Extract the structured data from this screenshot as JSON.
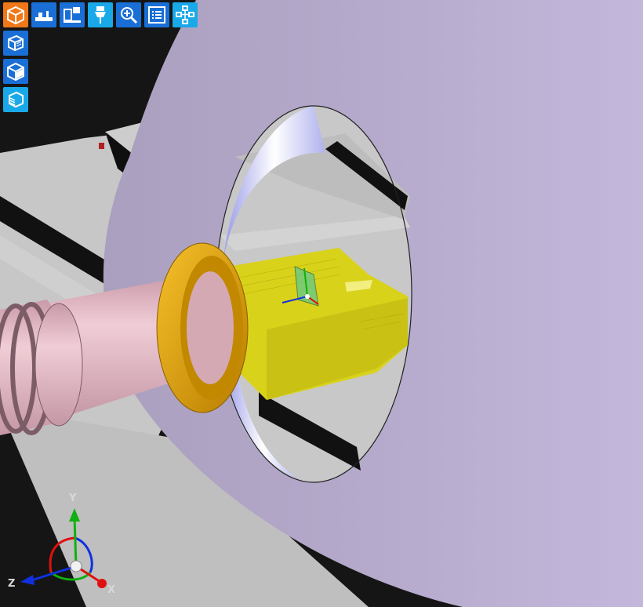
{
  "toolbar": {
    "buttons": [
      {
        "icon": "machine-view-icon",
        "color": "#f07818"
      },
      {
        "icon": "machine-setup-icon",
        "color": "#1a6fd6"
      },
      {
        "icon": "machine-panel-icon",
        "color": "#1a6fd6"
      },
      {
        "icon": "spindle-tool-icon",
        "color": "#1aa9e8"
      },
      {
        "icon": "zoom-icon",
        "color": "#1a6fd6"
      },
      {
        "icon": "list-icon",
        "color": "#1a6fd6"
      },
      {
        "icon": "network-icon",
        "color": "#1aa9e8"
      }
    ],
    "view_buttons": [
      {
        "icon": "front-view-icon",
        "color": "#1a6fd6"
      },
      {
        "icon": "iso-view-icon",
        "color": "#1a6fd6"
      },
      {
        "icon": "side-view-icon",
        "color": "#1aa9e8"
      }
    ]
  },
  "axes": {
    "x_label": "X",
    "y_label": "Y",
    "z_label": "Z",
    "x_color": "#e01010",
    "y_color": "#10b010",
    "z_color": "#1030e0"
  },
  "colors": {
    "housing": "#bdb0d4",
    "stock": "#d9d21a",
    "chuck_ring": "#e0a30a",
    "spindle": "#e5bcc7",
    "bed": "#c9c9c9"
  }
}
